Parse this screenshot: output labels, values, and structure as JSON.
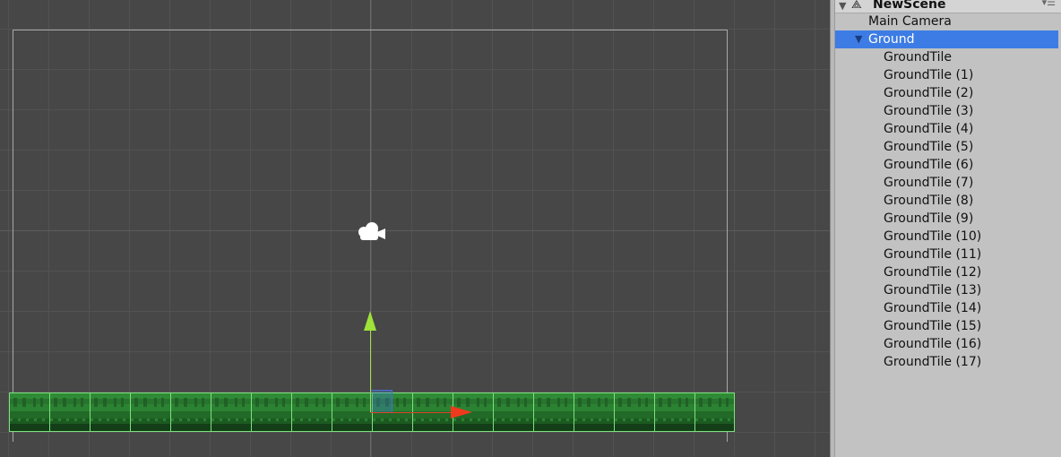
{
  "scene_view": {
    "tile_count": 18,
    "gizmo_colors": {
      "x_axis": "#ef3a1d",
      "y_axis": "#9ee23a",
      "plane": "#4a6fd8"
    },
    "camera_icon": "camera-icon"
  },
  "hierarchy": {
    "scene_name": "NewScene",
    "scene_icon": "unity-logo-icon",
    "menu_icon": "options-menu-icon",
    "items": [
      {
        "label": "Main Camera",
        "depth": 0,
        "selected": false
      },
      {
        "label": "Ground",
        "depth": 0,
        "selected": true,
        "expanded": true
      },
      {
        "label": "GroundTile",
        "depth": 1
      },
      {
        "label": "GroundTile (1)",
        "depth": 1
      },
      {
        "label": "GroundTile (2)",
        "depth": 1
      },
      {
        "label": "GroundTile (3)",
        "depth": 1
      },
      {
        "label": "GroundTile (4)",
        "depth": 1
      },
      {
        "label": "GroundTile (5)",
        "depth": 1
      },
      {
        "label": "GroundTile (6)",
        "depth": 1
      },
      {
        "label": "GroundTile (7)",
        "depth": 1
      },
      {
        "label": "GroundTile (8)",
        "depth": 1
      },
      {
        "label": "GroundTile (9)",
        "depth": 1
      },
      {
        "label": "GroundTile (10)",
        "depth": 1
      },
      {
        "label": "GroundTile (11)",
        "depth": 1
      },
      {
        "label": "GroundTile (12)",
        "depth": 1
      },
      {
        "label": "GroundTile (13)",
        "depth": 1
      },
      {
        "label": "GroundTile (14)",
        "depth": 1
      },
      {
        "label": "GroundTile (15)",
        "depth": 1
      },
      {
        "label": "GroundTile (16)",
        "depth": 1
      },
      {
        "label": "GroundTile (17)",
        "depth": 1
      }
    ]
  }
}
